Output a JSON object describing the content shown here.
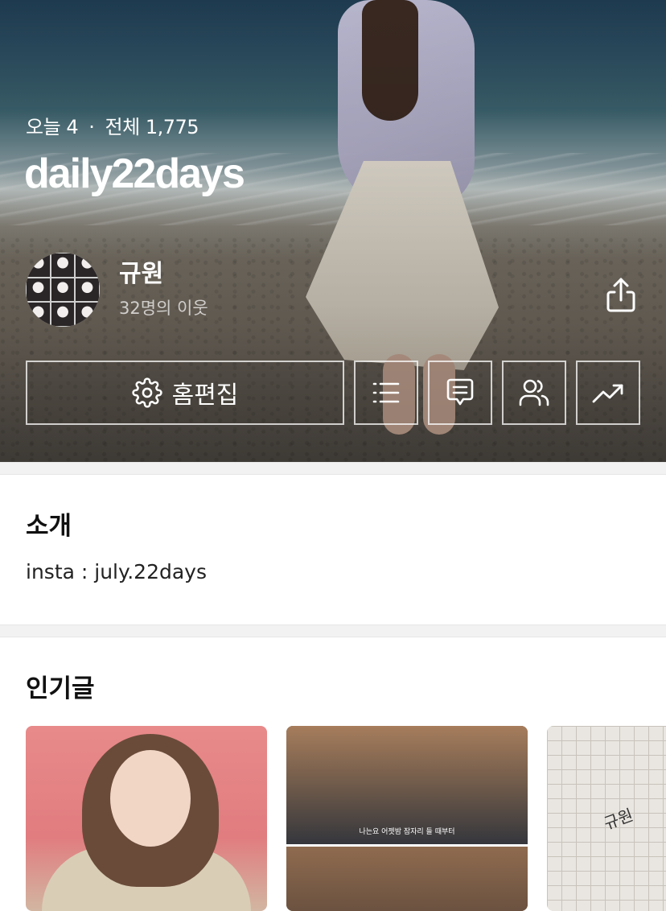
{
  "hero": {
    "stats": {
      "today_label": "오늘",
      "today_count": "4",
      "separator": "·",
      "total_label": "전체",
      "total_count": "1,775"
    },
    "blog_title": "daily22days",
    "profile": {
      "nickname": "규원",
      "neighbors": "32명의 이웃"
    },
    "actions": {
      "edit_label": "홈편집",
      "icons": [
        "gear-icon",
        "list-icon",
        "comment-icon",
        "neighbors-icon",
        "stats-trend-icon",
        "share-icon"
      ]
    }
  },
  "intro": {
    "title": "소개",
    "text": "insta : july.22days"
  },
  "popular": {
    "title": "인기글",
    "cards": [
      {
        "thumb": "woman-heart-hands-photo"
      },
      {
        "thumb": "drama-still-photo",
        "subtitle": "나는요 어젯밤 잠자리 들 때부터"
      },
      {
        "thumb": "grid-paper-doodle-photo",
        "doodle": "규원"
      }
    ]
  },
  "colors": {
    "text_primary": "#111111",
    "separator": "#f2f2f2",
    "hero_text": "#ffffff"
  }
}
